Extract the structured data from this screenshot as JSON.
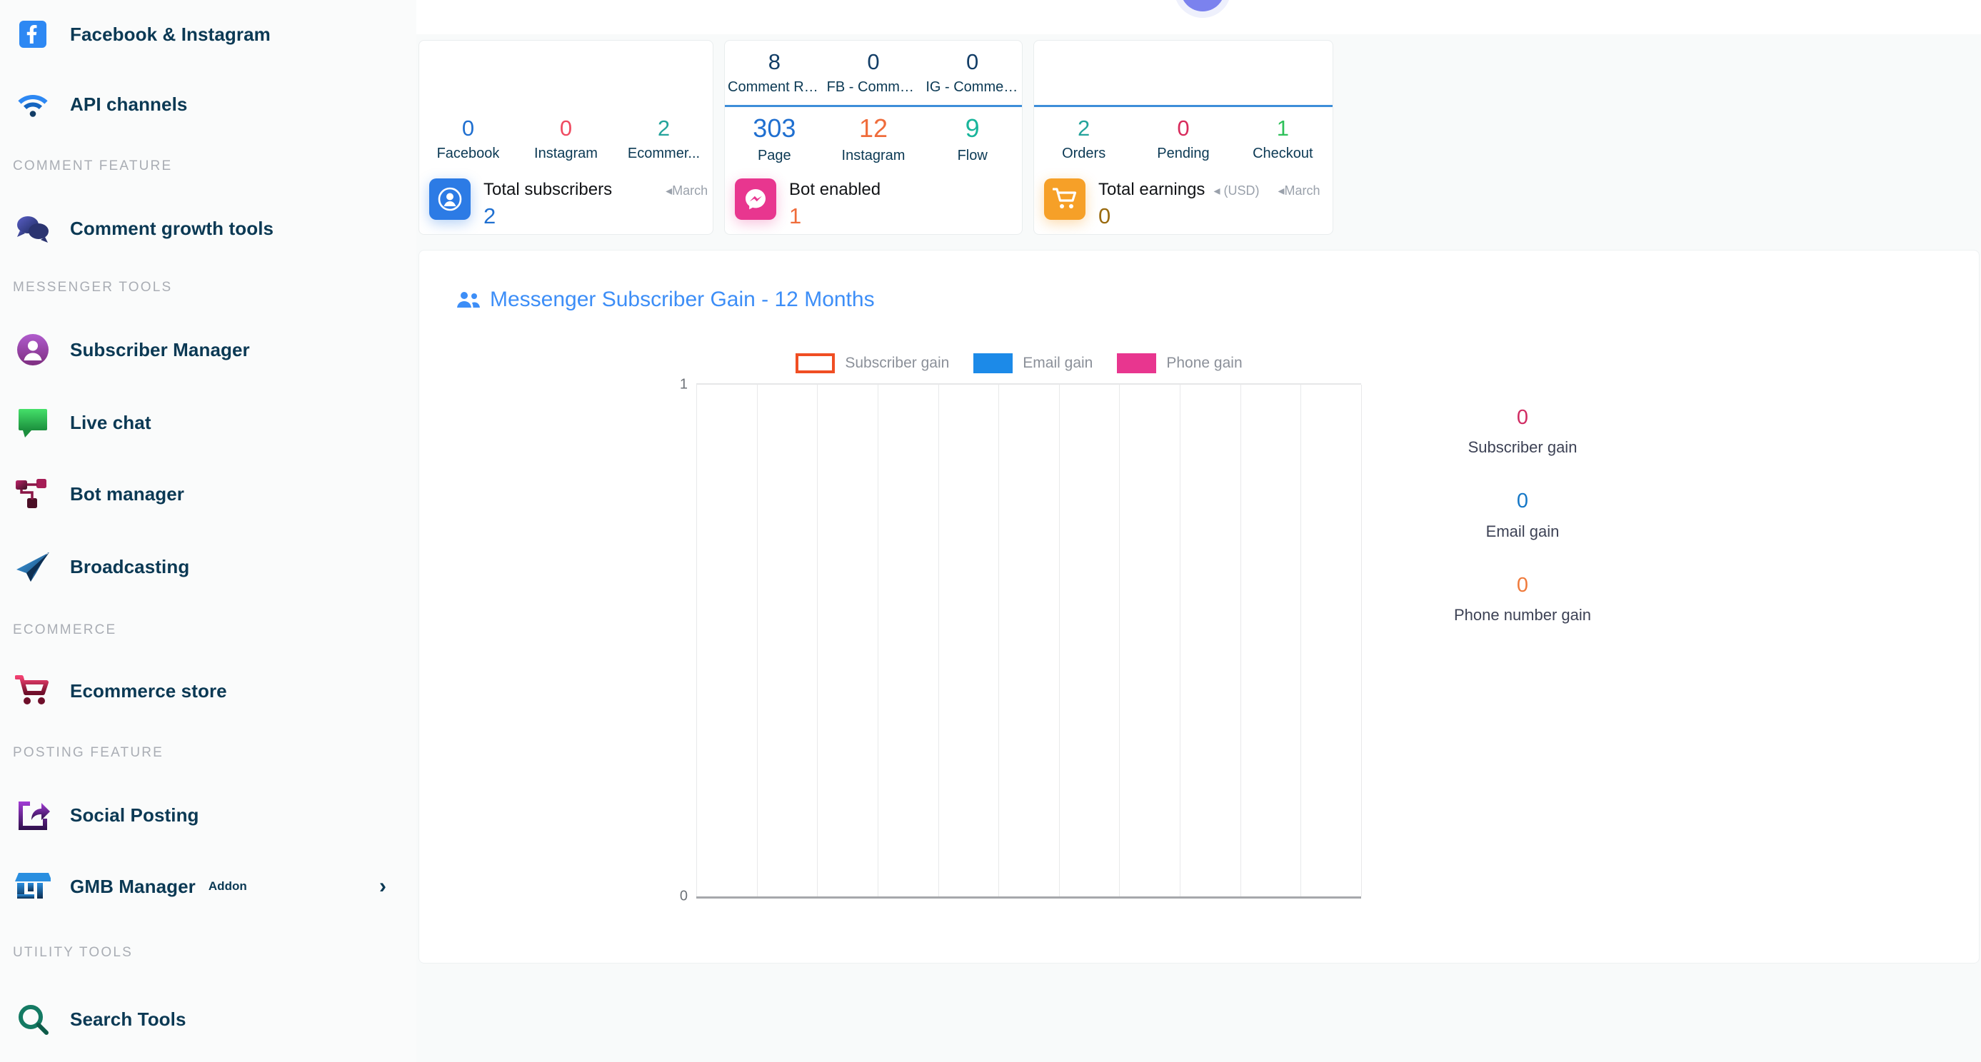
{
  "sidebar": {
    "items": [
      {
        "type": "item",
        "id": "facebook-instagram",
        "label": "Facebook & Instagram",
        "icon": "facebook-icon"
      },
      {
        "type": "item",
        "id": "api-channels",
        "label": "API channels",
        "icon": "wifi-icon"
      },
      {
        "type": "section",
        "id": "comment-feature",
        "label": "COMMENT FEATURE"
      },
      {
        "type": "item",
        "id": "comment-growth-tools",
        "label": "Comment growth tools",
        "icon": "chat-bubbles-icon"
      },
      {
        "type": "section",
        "id": "messenger-tools",
        "label": "MESSENGER TOOLS"
      },
      {
        "type": "item",
        "id": "subscriber-manager",
        "label": "Subscriber Manager",
        "icon": "user-circle-icon"
      },
      {
        "type": "item",
        "id": "live-chat",
        "label": "Live chat",
        "icon": "speech-bubble-icon"
      },
      {
        "type": "item",
        "id": "bot-manager",
        "label": "Bot manager",
        "icon": "sitemap-icon"
      },
      {
        "type": "item",
        "id": "broadcasting",
        "label": "Broadcasting",
        "icon": "paper-plane-icon"
      },
      {
        "type": "section",
        "id": "ecommerce",
        "label": "ECOMMERCE"
      },
      {
        "type": "item",
        "id": "ecommerce-store",
        "label": "Ecommerce store",
        "icon": "shopping-cart-icon"
      },
      {
        "type": "section",
        "id": "posting-feature",
        "label": "POSTING FEATURE"
      },
      {
        "type": "item",
        "id": "social-posting",
        "label": "Social Posting",
        "icon": "share-square-icon"
      },
      {
        "type": "item",
        "id": "gmb-manager",
        "label": "GMB Manager",
        "badge": "Addon",
        "chevron": "›",
        "icon": "storefront-icon"
      },
      {
        "type": "section",
        "id": "utility-tools",
        "label": "UTILITY TOOLS"
      },
      {
        "type": "item",
        "id": "search-tools",
        "label": "Search Tools",
        "icon": "search-circle-icon"
      }
    ]
  },
  "cards": [
    {
      "id": "total-subscribers",
      "top_row": [],
      "mid_row": [
        {
          "value": "0",
          "label": "Facebook",
          "color": "#1f6fd0"
        },
        {
          "value": "0",
          "label": "Instagram",
          "color": "#ef4a60"
        },
        {
          "value": "2",
          "label": "Ecommer...",
          "color": "#23a39b"
        }
      ],
      "tile_icon": "user-badge-icon",
      "tile_color": "#2c7be5",
      "title": "Total subscribers",
      "sub": "",
      "month": "◂March",
      "value": "2",
      "value_color": "#1f6fd0"
    },
    {
      "id": "bot-enabled",
      "top_row": [
        {
          "value": "8",
          "label": "Comment Repl...",
          "color": "#123d66"
        },
        {
          "value": "0",
          "label": "FB - Comment ...",
          "color": "#123d66"
        },
        {
          "value": "0",
          "label": "IG - Comment ...",
          "color": "#123d66"
        }
      ],
      "mid_row": [
        {
          "value": "303",
          "label": "Page",
          "color": "#1f6fd0"
        },
        {
          "value": "12",
          "label": "Instagram",
          "color": "#ef6c3b"
        },
        {
          "value": "9",
          "label": "Flow",
          "color": "#19b59b"
        }
      ],
      "tile_icon": "messenger-icon",
      "tile_color": "#e8368f",
      "title": "Bot enabled",
      "sub": "",
      "month": "",
      "value": "1",
      "value_color": "#ef6c3b"
    },
    {
      "id": "total-earnings",
      "top_row": [],
      "mid_row": [
        {
          "value": "2",
          "label": "Orders",
          "color": "#23a39b"
        },
        {
          "value": "0",
          "label": "Pending",
          "color": "#d82b5c"
        },
        {
          "value": "1",
          "label": "Checkout",
          "color": "#2fc15a"
        }
      ],
      "tile_icon": "shopping-cart-icon",
      "tile_color": "#f6a028",
      "title": "Total earnings",
      "sub": "◂ (USD)",
      "month": "◂March",
      "value": "0",
      "value_color": "#9a6b10"
    }
  ],
  "chart_panel": {
    "title": "Messenger Subscriber Gain - 12 Months",
    "title_icon": "users-icon",
    "side_stats": [
      {
        "value": "0",
        "label": "Subscriber gain",
        "color": "#d02b62"
      },
      {
        "value": "0",
        "label": "Email gain",
        "color": "#1577c6"
      },
      {
        "value": "0",
        "label": "Phone number gain",
        "color": "#ef7a3b"
      }
    ]
  },
  "chart_data": {
    "type": "bar",
    "title": "Messenger Subscriber Gain - 12 Months",
    "xlabel": "",
    "ylabel": "",
    "ylim": [
      0,
      1
    ],
    "ytick_labels": [
      "0",
      "1"
    ],
    "grid": true,
    "gridlines_vertical": 12,
    "legend_position": "top-center",
    "categories": [
      "",
      "",
      "",
      "",
      "",
      "",
      "",
      "",
      "",
      "",
      "",
      ""
    ],
    "series": [
      {
        "name": "Subscriber gain",
        "color": "#f04e23",
        "hidden": true,
        "values": [
          0,
          0,
          0,
          0,
          0,
          0,
          0,
          0,
          0,
          0,
          0,
          0
        ]
      },
      {
        "name": "Email gain",
        "color": "#1c8ae8",
        "hidden": false,
        "values": [
          0,
          0,
          0,
          0,
          0,
          0,
          0,
          0,
          0,
          0,
          0,
          0
        ]
      },
      {
        "name": "Phone gain",
        "color": "#e8368f",
        "hidden": false,
        "values": [
          0,
          0,
          0,
          0,
          0,
          0,
          0,
          0,
          0,
          0,
          0,
          0
        ]
      }
    ]
  }
}
